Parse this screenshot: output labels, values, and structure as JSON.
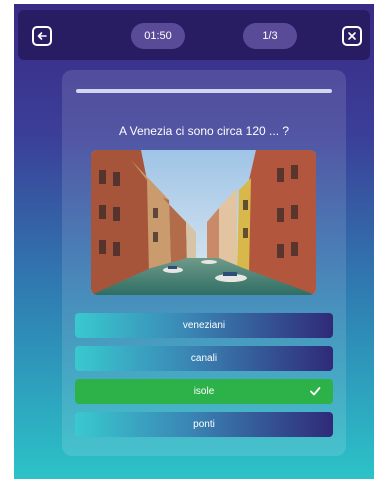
{
  "header": {
    "timer": "01:50",
    "question_counter": "1/3"
  },
  "quiz": {
    "progress": 1.0,
    "question": "A Venezia ci sono circa 120 ... ?",
    "answers": [
      {
        "label": "veneziani",
        "state": "default"
      },
      {
        "label": "canali",
        "state": "default"
      },
      {
        "label": "isole",
        "state": "correct"
      },
      {
        "label": "ponti",
        "state": "default"
      }
    ]
  },
  "colors": {
    "topbar": "#281d63",
    "pill": "#5a4b98",
    "correct": "#2db24a",
    "answer_start": "#39c9cf",
    "answer_end": "#2f2a78"
  },
  "icons": {
    "back": "arrow-left-icon",
    "close": "close-icon",
    "check": "check-icon"
  }
}
